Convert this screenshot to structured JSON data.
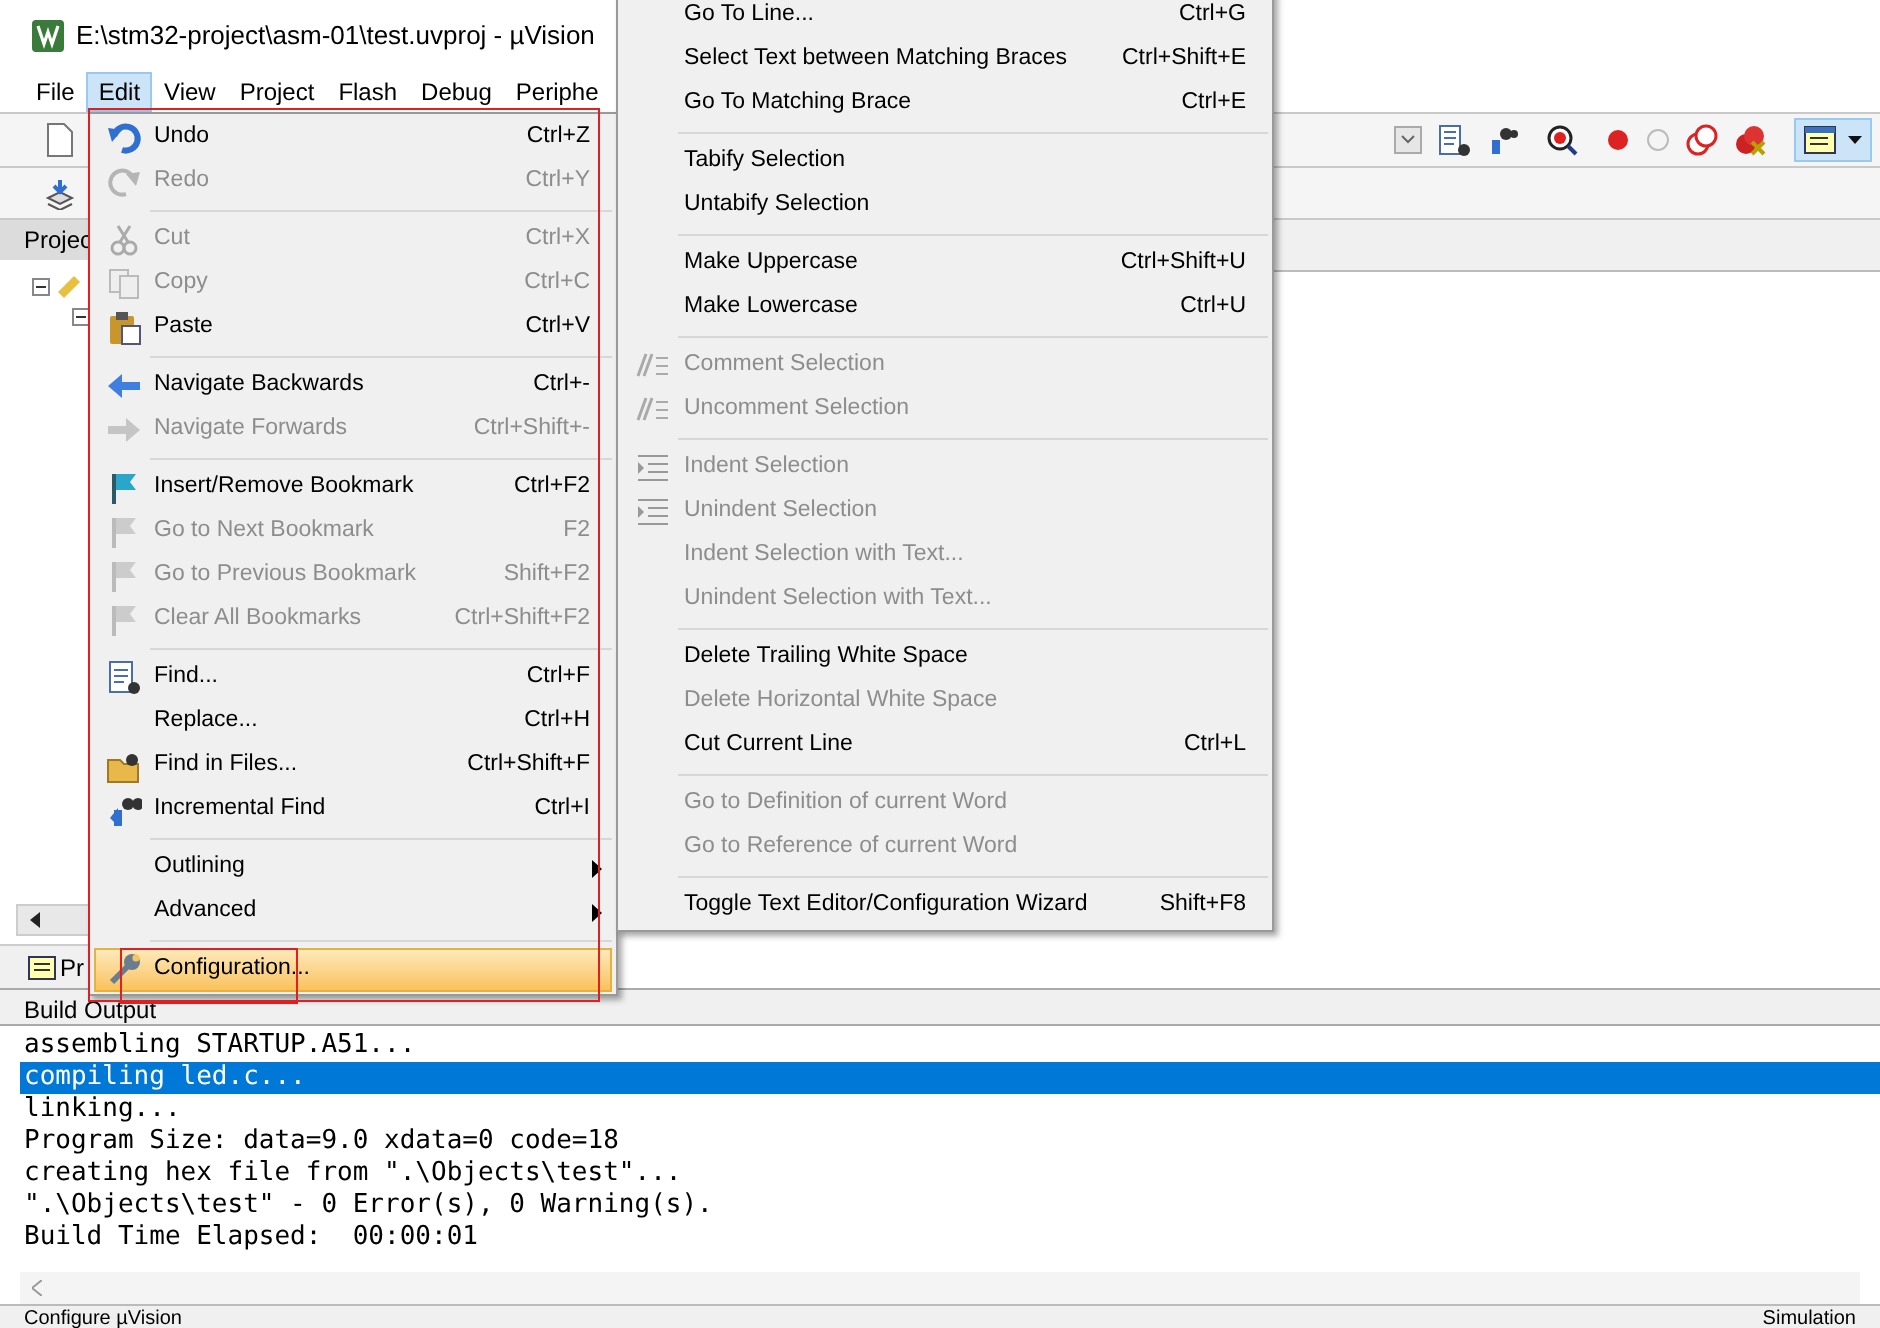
{
  "window": {
    "title": "E:\\stm32-project\\asm-01\\test.uvproj - µVision"
  },
  "menu_bar": [
    {
      "label": "File",
      "selected": false
    },
    {
      "label": "Edit",
      "selected": true
    },
    {
      "label": "View",
      "selected": false
    },
    {
      "label": "Project",
      "selected": false
    },
    {
      "label": "Flash",
      "selected": false
    },
    {
      "label": "Debug",
      "selected": false
    },
    {
      "label": "Periphe",
      "selected": false
    }
  ],
  "project_pane": {
    "tab": "Projec",
    "bottom_tab": "Pr"
  },
  "edit_menu": [
    [
      {
        "label": "Undo",
        "shortcut": "Ctrl+Z",
        "disabled": false,
        "kind": "undo"
      },
      {
        "label": "Redo",
        "shortcut": "Ctrl+Y",
        "disabled": true,
        "kind": "redo"
      }
    ],
    [
      {
        "label": "Cut",
        "shortcut": "Ctrl+X",
        "disabled": true,
        "kind": "cut"
      },
      {
        "label": "Copy",
        "shortcut": "Ctrl+C",
        "disabled": true,
        "kind": "copy"
      },
      {
        "label": "Paste",
        "shortcut": "Ctrl+V",
        "disabled": false,
        "kind": "paste"
      }
    ],
    [
      {
        "label": "Navigate Backwards",
        "shortcut": "Ctrl+-",
        "disabled": false,
        "kind": "back"
      },
      {
        "label": "Navigate Forwards",
        "shortcut": "Ctrl+Shift+-",
        "disabled": true,
        "kind": "forward"
      }
    ],
    [
      {
        "label": "Insert/Remove Bookmark",
        "shortcut": "Ctrl+F2",
        "disabled": false,
        "kind": "flag"
      },
      {
        "label": "Go to Next Bookmark",
        "shortcut": "F2",
        "disabled": true,
        "kind": "flag"
      },
      {
        "label": "Go to Previous Bookmark",
        "shortcut": "Shift+F2",
        "disabled": true,
        "kind": "flag"
      },
      {
        "label": "Clear All Bookmarks",
        "shortcut": "Ctrl+Shift+F2",
        "disabled": true,
        "kind": "flag"
      }
    ],
    [
      {
        "label": "Find...",
        "shortcut": "Ctrl+F",
        "disabled": false,
        "kind": "find"
      },
      {
        "label": "Replace...",
        "shortcut": "Ctrl+H",
        "disabled": false,
        "kind": "plain"
      },
      {
        "label": "Find in Files...",
        "shortcut": "Ctrl+Shift+F",
        "disabled": false,
        "kind": "folder"
      },
      {
        "label": "Incremental Find",
        "shortcut": "Ctrl+I",
        "disabled": false,
        "kind": "binoculars"
      }
    ],
    [
      {
        "label": "Outlining",
        "disabled": false,
        "submenu": true
      },
      {
        "label": "Advanced",
        "disabled": false,
        "submenu": true
      }
    ],
    [
      {
        "label": "Configuration...",
        "disabled": false,
        "selected": true,
        "kind": "wrench"
      }
    ]
  ],
  "advanced_menu": [
    [
      {
        "label": "Go To Line...",
        "shortcut": "Ctrl+G",
        "disabled": false
      },
      {
        "label": "Select Text between Matching Braces",
        "shortcut": "Ctrl+Shift+E",
        "disabled": false
      },
      {
        "label": "Go To Matching Brace",
        "shortcut": "Ctrl+E",
        "disabled": false
      }
    ],
    [
      {
        "label": "Tabify Selection",
        "disabled": false
      },
      {
        "label": "Untabify Selection",
        "disabled": false
      }
    ],
    [
      {
        "label": "Make Uppercase",
        "shortcut": "Ctrl+Shift+U",
        "disabled": false
      },
      {
        "label": "Make Lowercase",
        "shortcut": "Ctrl+U",
        "disabled": false
      }
    ],
    [
      {
        "label": "Comment Selection",
        "disabled": true,
        "kind": "comment"
      },
      {
        "label": "Uncomment Selection",
        "disabled": true,
        "kind": "comment"
      }
    ],
    [
      {
        "label": "Indent Selection",
        "disabled": true,
        "kind": "indent"
      },
      {
        "label": "Unindent Selection",
        "disabled": true,
        "kind": "indent"
      },
      {
        "label": "Indent Selection with Text...",
        "disabled": true
      },
      {
        "label": "Unindent Selection with Text...",
        "disabled": true
      }
    ],
    [
      {
        "label": "Delete Trailing White Space",
        "disabled": false
      },
      {
        "label": "Delete Horizontal White Space",
        "disabled": true
      },
      {
        "label": "Cut Current Line",
        "shortcut": "Ctrl+L",
        "disabled": false
      }
    ],
    [
      {
        "label": "Go to Definition of current Word",
        "disabled": true
      },
      {
        "label": "Go to Reference of current Word",
        "disabled": true
      }
    ],
    [
      {
        "label": "Toggle Text Editor/Configuration Wizard",
        "shortcut": "Shift+F8",
        "disabled": false
      }
    ]
  ],
  "build_output": {
    "title": "Build Output",
    "lines": [
      {
        "text": "assembling STARTUP.A51...",
        "selected": false
      },
      {
        "text": "compiling led.c...",
        "selected": true
      },
      {
        "text": "linking...",
        "selected": false
      },
      {
        "text": "Program Size: data=9.0 xdata=0 code=18",
        "selected": false
      },
      {
        "text": "creating hex file from \".\\Objects\\test\"...",
        "selected": false
      },
      {
        "text": "\".\\Objects\\test\" - 0 Error(s), 0 Warning(s).",
        "selected": false
      },
      {
        "text": "Build Time Elapsed:  00:00:01",
        "selected": false
      }
    ]
  },
  "status_bar": {
    "left": "Configure µVision",
    "right": "Simulation"
  }
}
